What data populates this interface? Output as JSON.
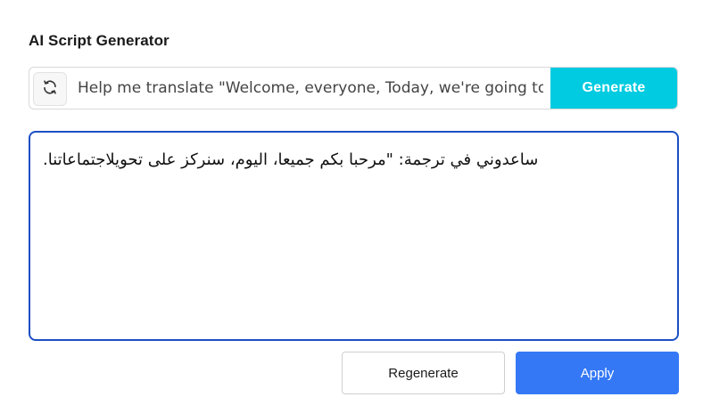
{
  "panel": {
    "title": "AI Script Generator"
  },
  "prompt": {
    "value": "Help me translate \"Welcome, everyone, Today, we're going to foc",
    "refresh_icon": "refresh-icon",
    "generate_label": "Generate",
    "generate_color": "#00cbe0"
  },
  "output": {
    "text": "ساعدوني في ترجمة: \"مرحبا بكم جميعا، اليوم، سنركز على تحويلاجتماعاتنا.",
    "border_color": "#1c4fc4"
  },
  "actions": {
    "regenerate_label": "Regenerate",
    "apply_label": "Apply",
    "apply_color": "#3478f6"
  }
}
